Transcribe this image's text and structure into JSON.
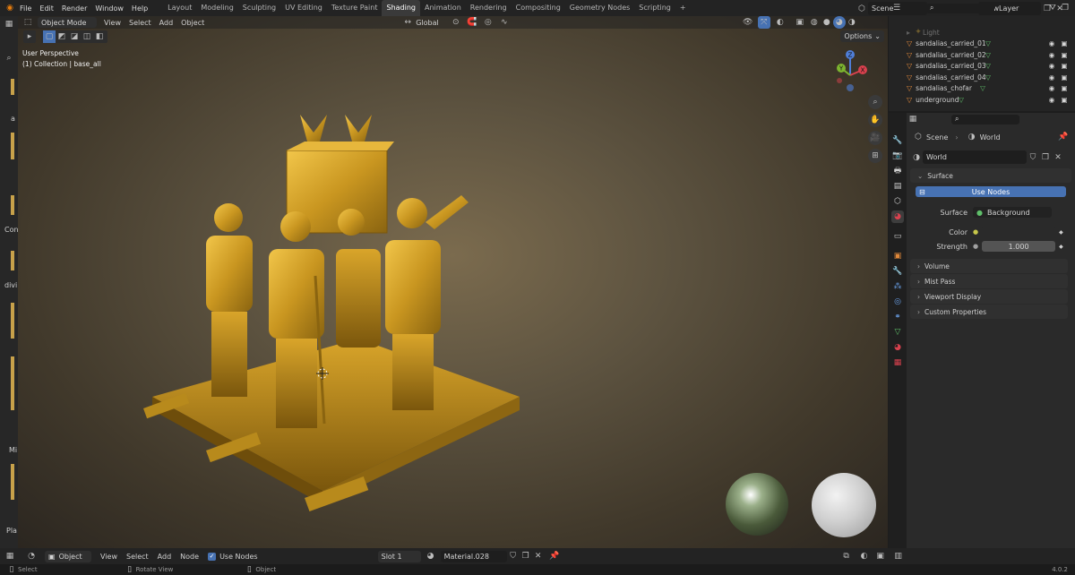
{
  "topbar": {
    "menus": [
      "File",
      "Edit",
      "Render",
      "Window",
      "Help"
    ],
    "workspaces": [
      "Layout",
      "Modeling",
      "Sculpting",
      "UV Editing",
      "Texture Paint",
      "Shading",
      "Animation",
      "Rendering",
      "Compositing",
      "Geometry Nodes",
      "Scripting"
    ],
    "active_workspace": "Shading",
    "add_tab": "+",
    "scene": "Scene",
    "view_layer": "ViewLayer"
  },
  "viewport": {
    "mode": "Object Mode",
    "menus": [
      "View",
      "Select",
      "Add",
      "Object"
    ],
    "orientation": "Global",
    "options": "Options",
    "perspective": "User Perspective",
    "collection_info": "(1) Collection | base_all",
    "gizmo": {
      "z": "Z",
      "y": "Y",
      "x": "X"
    }
  },
  "left_toolbar": {
    "labels": [
      "a",
      "Con",
      "divi",
      "Mi",
      "Pla"
    ]
  },
  "outliner": {
    "search_placeholder": "",
    "items": [
      {
        "name": "Light",
        "dim": true
      },
      {
        "name": "sandalias_carried_01"
      },
      {
        "name": "sandalias_carried_02"
      },
      {
        "name": "sandalias_carried_03"
      },
      {
        "name": "sandalias_carried_04"
      },
      {
        "name": "sandalias_chofar"
      },
      {
        "name": "underground"
      }
    ]
  },
  "properties": {
    "breadcrumb": {
      "scene": "Scene",
      "world": "World"
    },
    "world_name": "World",
    "surface_header": "Surface",
    "use_nodes": "Use Nodes",
    "surface_label": "Surface",
    "surface_value": "Background",
    "color_label": "Color",
    "strength_label": "Strength",
    "strength_value": "1.000",
    "panels": [
      "Volume",
      "Mist Pass",
      "Viewport Display",
      "Custom Properties"
    ]
  },
  "node_header": {
    "mode": "Object",
    "menus": [
      "View",
      "Select",
      "Add",
      "Node"
    ],
    "use_nodes_label": "Use Nodes",
    "slot": "Slot 1",
    "material": "Material.028"
  },
  "status": {
    "select": "Select",
    "rotate": "Rotate View",
    "object": "Object",
    "version": "4.0.2"
  },
  "colors": {
    "accent_blue": "#4772b3",
    "gold": "#c9a13a",
    "mesh_green": "#5fbf6a",
    "object_orange": "#e0883a"
  }
}
